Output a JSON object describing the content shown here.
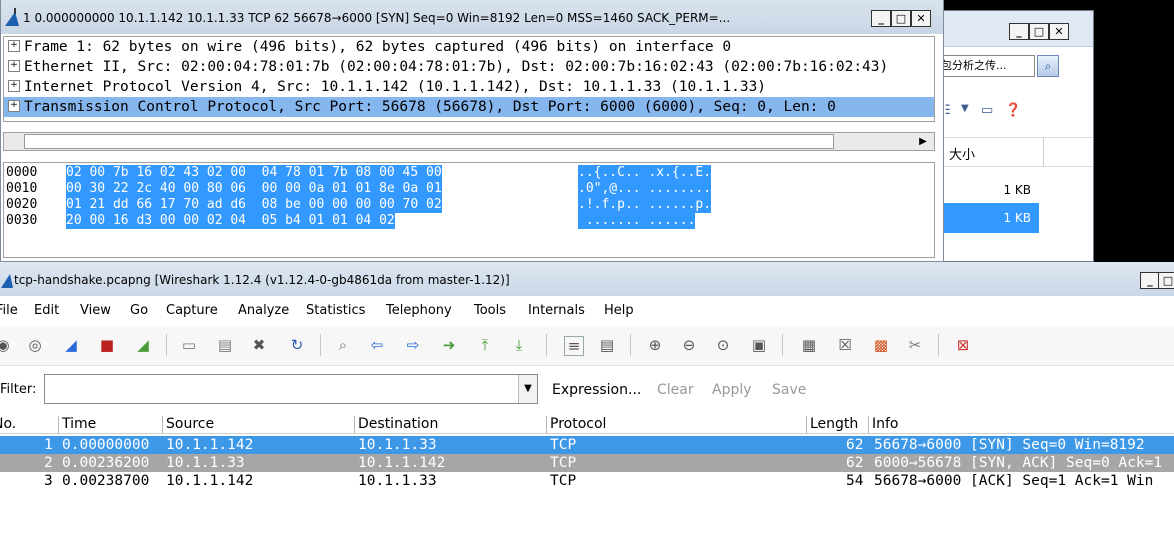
{
  "dialog": {
    "title": "1 0.000000000 10.1.1.142 10.1.1.33 TCP 62 56678→6000 [SYN] Seq=0 Win=8192 Len=0 MSS=1460 SACK_PERM=...",
    "tree": [
      {
        "text": "Frame 1: 62 bytes on wire (496 bits), 62 bytes captured (496 bits) on interface 0"
      },
      {
        "text": "Ethernet II, Src: 02:00:04:78:01:7b (02:00:04:78:01:7b), Dst: 02:00:7b:16:02:43 (02:00:7b:16:02:43)"
      },
      {
        "text": "Internet Protocol Version 4, Src: 10.1.1.142 (10.1.1.142), Dst: 10.1.1.33 (10.1.1.33)"
      },
      {
        "text": "Transmission Control Protocol, Src Port: 56678 (56678), Dst Port: 6000 (6000), Seq: 0, Len: 0"
      }
    ],
    "hex": [
      {
        "offset": "0000",
        "bytes": "02 00 7b 16 02 43 02 00  04 78 01 7b 08 00 45 00",
        "ascii": "..{..C.. .x.{..E."
      },
      {
        "offset": "0010",
        "bytes": "00 30 22 2c 40 00 80 06  00 00 0a 01 01 8e 0a 01",
        "ascii": ".0\",@... ........"
      },
      {
        "offset": "0020",
        "bytes": "01 21 dd 66 17 70 ad d6  08 be 00 00 00 00 70 02",
        "ascii": ".!.f.p.. ......p."
      },
      {
        "offset": "0030",
        "bytes": "20 00 16 d3 00 00 02 04  05 b4 01 01 04 02",
        "ascii": " ....... ......"
      }
    ]
  },
  "explorer": {
    "search_text": "包分析之传...",
    "column_size": "大小",
    "rows": [
      "1 KB",
      "1 KB"
    ]
  },
  "main": {
    "title": "tcp-handshake.pcapng   [Wireshark 1.12.4  (v1.12.4-0-gb4861da from master-1.12)]",
    "menu": [
      "File",
      "Edit",
      "View",
      "Go",
      "Capture",
      "Analyze",
      "Statistics",
      "Telephony",
      "Tools",
      "Internals",
      "Help"
    ],
    "filter_label": "Filter:",
    "filter_value": "",
    "filter_buttons": [
      "Expression...",
      "Clear",
      "Apply",
      "Save"
    ],
    "columns": [
      "No.",
      "Time",
      "Source",
      "Destination",
      "Protocol",
      "Length",
      "Info"
    ],
    "packets": [
      {
        "no": "1",
        "time": "0.00000000",
        "source": "10.1.1.142",
        "destination": "10.1.1.33",
        "protocol": "TCP",
        "length": "62",
        "info": "56678→6000 [SYN] Seq=0 Win=8192"
      },
      {
        "no": "2",
        "time": "0.00236200",
        "source": "10.1.1.33",
        "destination": "10.1.1.142",
        "protocol": "TCP",
        "length": "62",
        "info": "6000→56678 [SYN, ACK] Seq=0 Ack=1"
      },
      {
        "no": "3",
        "time": "0.00238700",
        "source": "10.1.1.142",
        "destination": "10.1.1.33",
        "protocol": "TCP",
        "length": "54",
        "info": "56678→6000 [ACK] Seq=1 Ack=1 Win"
      }
    ]
  },
  "colors": {
    "selection": "#3399ff",
    "tree_selection": "#86b6ee",
    "gray_row": "#a6a6a6"
  }
}
